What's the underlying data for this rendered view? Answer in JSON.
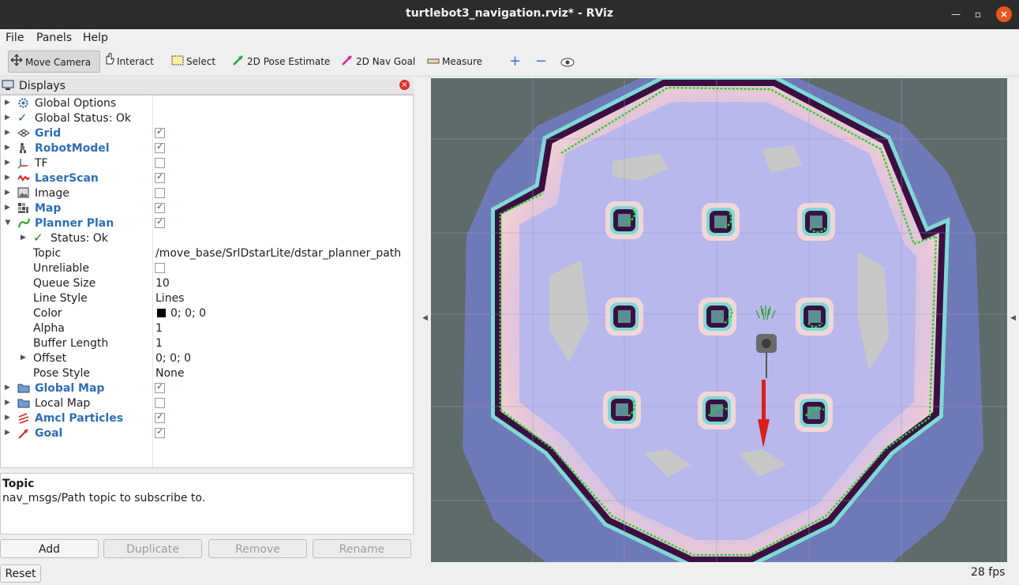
{
  "window": {
    "title": "turtlebot3_navigation.rviz* - RViz"
  },
  "menu": {
    "file": "File",
    "panels": "Panels",
    "help": "Help"
  },
  "toolbar": {
    "move_camera": "Move Camera",
    "interact": "Interact",
    "select": "Select",
    "pose_estimate": "2D Pose Estimate",
    "nav_goal": "2D Nav Goal",
    "measure": "Measure"
  },
  "displays": {
    "title": "Displays",
    "items": [
      {
        "label": "Global Options",
        "icon": "gear-icon"
      },
      {
        "label": "Global Status: Ok",
        "icon": "check-icon"
      },
      {
        "label": "Grid",
        "icon": "grid-icon",
        "checked": true
      },
      {
        "label": "RobotModel",
        "icon": "robot-icon",
        "checked": true
      },
      {
        "label": "TF",
        "icon": "axes-icon",
        "checked": false
      },
      {
        "label": "LaserScan",
        "icon": "laser-icon",
        "checked": true
      },
      {
        "label": "Image",
        "icon": "image-icon",
        "checked": false
      },
      {
        "label": "Map",
        "icon": "map-icon",
        "checked": true
      },
      {
        "label": "Planner Plan",
        "icon": "path-icon",
        "checked": true
      },
      {
        "label": "Global Map",
        "icon": "folder-icon",
        "checked": true
      },
      {
        "label": "Local Map",
        "icon": "folder-icon",
        "checked": false
      },
      {
        "label": "Amcl Particles",
        "icon": "particles-icon",
        "checked": true
      },
      {
        "label": "Goal",
        "icon": "goal-icon",
        "checked": true
      }
    ],
    "planner_plan": {
      "status": "Status: Ok",
      "props": [
        {
          "name": "Topic",
          "value": "/move_base/SrlDstarLite/dstar_planner_path"
        },
        {
          "name": "Unreliable",
          "value": ""
        },
        {
          "name": "Queue Size",
          "value": "10"
        },
        {
          "name": "Line Style",
          "value": "Lines"
        },
        {
          "name": "Color",
          "value": "0; 0; 0"
        },
        {
          "name": "Alpha",
          "value": "1"
        },
        {
          "name": "Buffer Length",
          "value": "1"
        },
        {
          "name": "Offset",
          "value": "0; 0; 0"
        },
        {
          "name": "Pose Style",
          "value": "None"
        }
      ]
    }
  },
  "description": {
    "title": "Topic",
    "text": "nav_msgs/Path topic to subscribe to."
  },
  "buttons": {
    "add": "Add",
    "duplicate": "Duplicate",
    "remove": "Remove",
    "rename": "Rename"
  },
  "status": {
    "reset": "Reset",
    "fps": "28 fps"
  },
  "colors": {
    "accent": "#2e6eb5",
    "close": "#e95420"
  }
}
